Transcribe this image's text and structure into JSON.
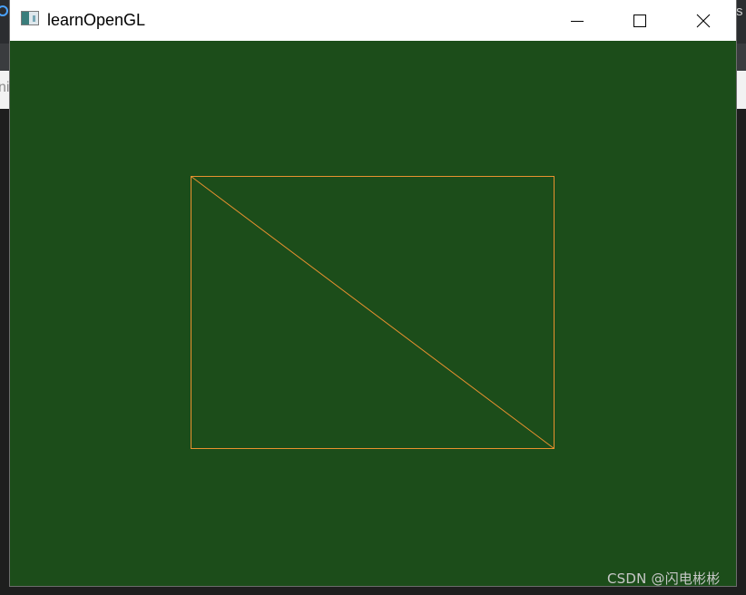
{
  "background": {
    "left_fragment_text": "ni",
    "right_fragment_text": "s"
  },
  "window": {
    "title": "learnOpenGL",
    "app_icon": "app-window-icon",
    "controls": {
      "minimize_icon": "minimize-icon",
      "maximize_icon": "maximize-icon",
      "close_icon": "close-icon"
    }
  },
  "viewport": {
    "clear_color": "#1c4d1a",
    "line_color": "#e8912f",
    "render_mode": "wireframe",
    "shape": "rectangle-two-triangles"
  },
  "watermark": {
    "text": "CSDN @闪电彬彬"
  }
}
